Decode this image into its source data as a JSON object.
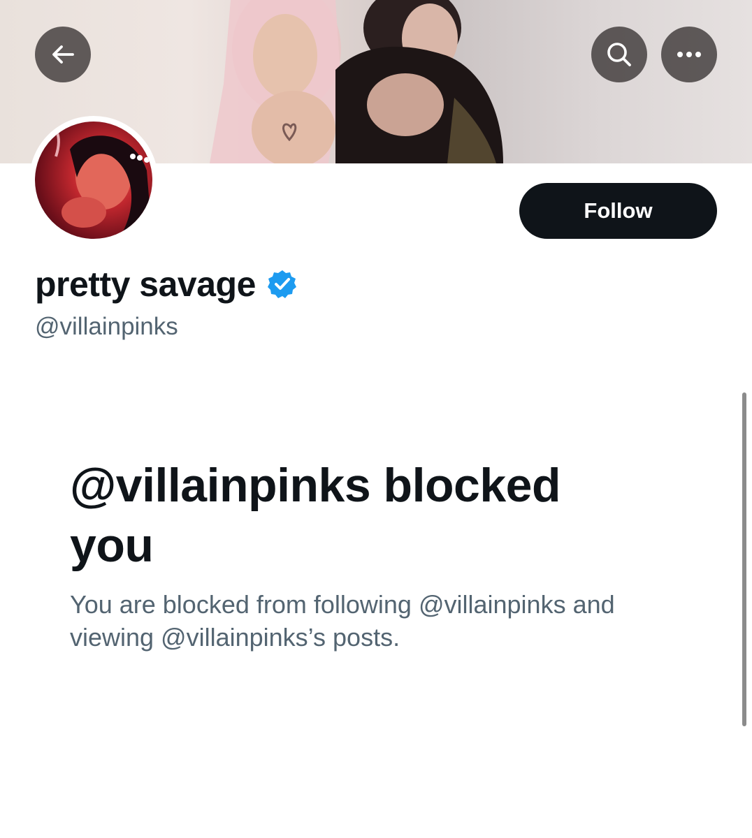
{
  "header": {
    "back_icon": "arrow-left-icon",
    "search_icon": "search-icon",
    "more_icon": "more-horizontal-icon"
  },
  "profile": {
    "display_name": "pretty savage",
    "verified": true,
    "verified_color": "#1d9bf0",
    "handle": "@villainpinks",
    "follow_label": "Follow"
  },
  "blocked": {
    "title": "@villainpinks blocked you",
    "description": "You are blocked from following @villainpinks and viewing @villainpinks’s posts."
  },
  "colors": {
    "primary_text": "#0f1419",
    "secondary_text": "#536471",
    "button_bg": "#0f1419"
  }
}
